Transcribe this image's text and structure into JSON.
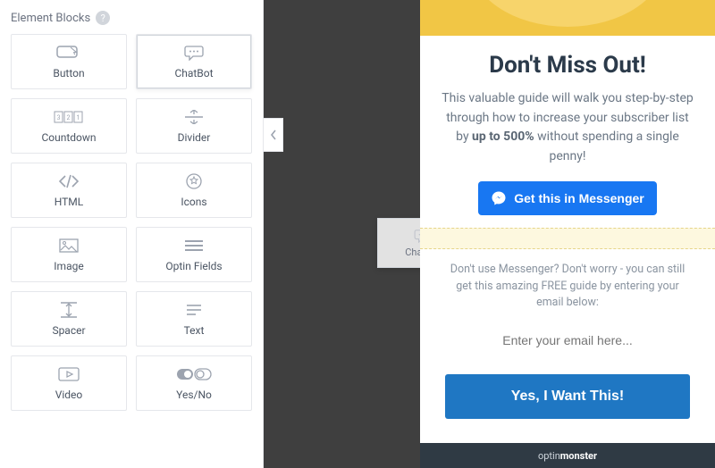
{
  "sidebar": {
    "title": "Element Blocks",
    "help": "?",
    "blocks": [
      {
        "label": "Button"
      },
      {
        "label": "ChatBot"
      },
      {
        "label": "Countdown"
      },
      {
        "label": "Divider"
      },
      {
        "label": "HTML"
      },
      {
        "label": "Icons"
      },
      {
        "label": "Image"
      },
      {
        "label": "Optin Fields"
      },
      {
        "label": "Spacer"
      },
      {
        "label": "Text"
      },
      {
        "label": "Video"
      },
      {
        "label": "Yes/No"
      }
    ]
  },
  "drag": {
    "label": "ChatBot"
  },
  "popup": {
    "title": "Don't Miss Out!",
    "desc_pre": "This valuable guide will walk you step-by-step through how to increase your subscriber list by ",
    "desc_bold": "up to 500%",
    "desc_post": " without spending a single penny!",
    "messenger_btn": "Get this in Messenger",
    "sub_text": "Don't use Messenger? Don't worry - you can still get this amazing FREE guide by entering your email below:",
    "email_placeholder": "Enter your email here...",
    "cta": "Yes, I Want This!",
    "brand_pre": "optin",
    "brand_bold": "monster"
  }
}
